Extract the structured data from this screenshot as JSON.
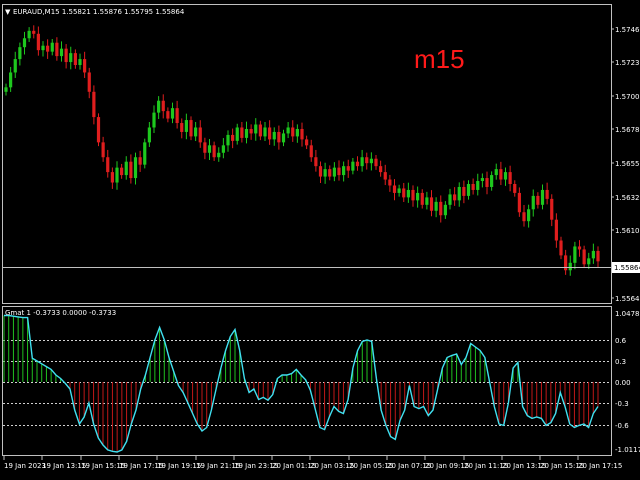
{
  "window": {
    "symbol_info": "EURAUD,M15  1.55821 1.55876 1.55795 1.55864",
    "timeframe_label": "m15",
    "indicator_info": "Gmat 1 -0.3733 0.0000 -0.3733",
    "current_price_label": "1.55864"
  },
  "colors": {
    "background": "#000000",
    "frame": "#c0c0c0",
    "bull_candle": "#1ec81e",
    "bear_candle": "#e01e1e",
    "indicator_line": "#40e0f0",
    "histogram_positive": "#20c020",
    "histogram_negative": "#c01818",
    "timeframe_text": "#ff1a1a"
  },
  "price_axis": {
    "labels": [
      "1.57460",
      "1.57230",
      "1.57005",
      "1.56780",
      "1.56550",
      "1.56325",
      "1.56100",
      "1.55645"
    ]
  },
  "indicator_axis": {
    "labels": [
      "1.0478",
      "0.6",
      "0.3",
      "0.00",
      "-0.3",
      "-0.6",
      "-1.0117"
    ]
  },
  "time_axis": {
    "labels": [
      "19 Jan 2023",
      "19 Jan 13:15",
      "19 Jan 15:15",
      "19 Jan 17:15",
      "19 Jan 19:15",
      "19 Jan 21:15",
      "19 Jan 23:15",
      "20 Jan 01:15",
      "20 Jan 03:15",
      "20 Jan 05:15",
      "20 Jan 07:15",
      "20 Jan 09:15",
      "20 Jan 11:15",
      "20 Jan 13:15",
      "20 Jan 15:15",
      "20 Jan 17:15"
    ]
  },
  "chart_data": [
    {
      "type": "candlestick",
      "title": "EURAUD,M15",
      "ylim": [
        1.556,
        1.5755
      ],
      "closes": [
        1.5703,
        1.5713,
        1.5722,
        1.573,
        1.5736,
        1.5741,
        1.5739,
        1.5728,
        1.5731,
        1.5727,
        1.5733,
        1.5724,
        1.5729,
        1.572,
        1.5726,
        1.5718,
        1.5722,
        1.5713,
        1.57,
        1.5683,
        1.5666,
        1.5656,
        1.5646,
        1.5639,
        1.5649,
        1.5644,
        1.5653,
        1.5642,
        1.5656,
        1.5651,
        1.5666,
        1.5676,
        1.5686,
        1.5694,
        1.5687,
        1.5682,
        1.5689,
        1.5679,
        1.5673,
        1.5681,
        1.567,
        1.5676,
        1.5666,
        1.5659,
        1.5664,
        1.5656,
        1.5659,
        1.5664,
        1.5671,
        1.5667,
        1.5676,
        1.5669,
        1.5675,
        1.5672,
        1.5678,
        1.567,
        1.5676,
        1.5668,
        1.5673,
        1.5666,
        1.5672,
        1.5676,
        1.567,
        1.5675,
        1.5668,
        1.5664,
        1.5656,
        1.565,
        1.5643,
        1.5648,
        1.5643,
        1.5649,
        1.5644,
        1.565,
        1.5647,
        1.5653,
        1.565,
        1.5656,
        1.5652,
        1.5655,
        1.565,
        1.5646,
        1.5641,
        1.5637,
        1.5632,
        1.5635,
        1.5629,
        1.5634,
        1.5627,
        1.5632,
        1.5624,
        1.5629,
        1.562,
        1.5626,
        1.5617,
        1.5624,
        1.5631,
        1.5627,
        1.5636,
        1.563,
        1.5638,
        1.5634,
        1.564,
        1.5642,
        1.5636,
        1.5644,
        1.5648,
        1.5641,
        1.5646,
        1.5638,
        1.5632,
        1.5619,
        1.5613,
        1.5621,
        1.563,
        1.5624,
        1.5634,
        1.5628,
        1.5614,
        1.56,
        1.559,
        1.558,
        1.5585,
        1.5596,
        1.5594,
        1.5584,
        1.5588,
        1.5593,
        1.5586
      ]
    },
    {
      "type": "line",
      "title": "Gmat 1",
      "ylim": [
        -1.0117,
        1.0478
      ],
      "values": [
        0.95,
        0.95,
        0.94,
        0.93,
        0.92,
        0.92,
        0.34,
        0.3,
        0.26,
        0.22,
        0.18,
        0.1,
        0.05,
        -0.02,
        -0.1,
        -0.4,
        -0.6,
        -0.5,
        -0.3,
        -0.6,
        -0.8,
        -0.9,
        -0.97,
        -0.99,
        -1.0,
        -0.97,
        -0.85,
        -0.6,
        -0.4,
        -0.1,
        0.1,
        0.35,
        0.6,
        0.78,
        0.6,
        0.35,
        0.15,
        -0.05,
        -0.15,
        -0.3,
        -0.45,
        -0.6,
        -0.7,
        -0.65,
        -0.4,
        -0.1,
        0.2,
        0.45,
        0.65,
        0.75,
        0.45,
        0.05,
        -0.15,
        -0.1,
        -0.25,
        -0.22,
        -0.26,
        -0.18,
        0.05,
        0.1,
        0.1,
        0.12,
        0.18,
        0.1,
        0.03,
        -0.12,
        -0.38,
        -0.65,
        -0.68,
        -0.5,
        -0.35,
        -0.42,
        -0.45,
        -0.25,
        0.2,
        0.45,
        0.58,
        0.6,
        0.58,
        0.05,
        -0.4,
        -0.62,
        -0.78,
        -0.82,
        -0.55,
        -0.4,
        -0.05,
        -0.35,
        -0.38,
        -0.35,
        -0.48,
        -0.4,
        -0.1,
        0.2,
        0.35,
        0.38,
        0.4,
        0.25,
        0.35,
        0.55,
        0.5,
        0.45,
        0.35,
        0.0,
        -0.35,
        -0.6,
        -0.62,
        -0.3,
        0.2,
        0.28,
        -0.35,
        -0.48,
        -0.52,
        -0.5,
        -0.52,
        -0.62,
        -0.58,
        -0.45,
        -0.15,
        -0.35,
        -0.6,
        -0.65,
        -0.62,
        -0.6,
        -0.65,
        -0.45,
        -0.35
      ]
    }
  ]
}
